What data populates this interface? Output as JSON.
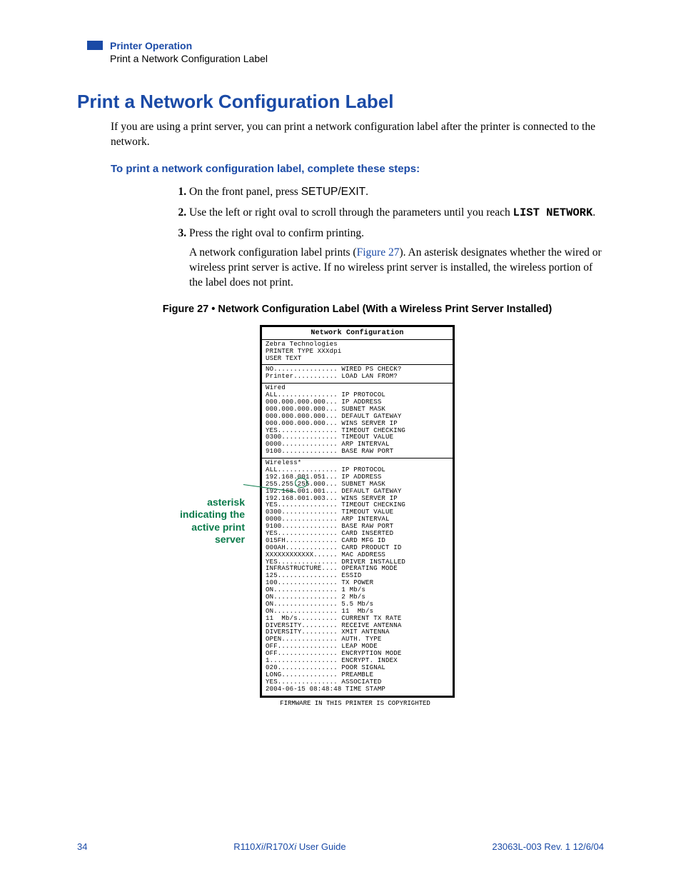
{
  "header": {
    "line1": "Printer Operation",
    "line2": "Print a Network Configuration Label"
  },
  "title": "Print a Network Configuration Label",
  "intro": "If you are using a print server, you can print a network configuration label after the printer is connected to the network.",
  "stepsHeading": "To print a network configuration label, complete these steps:",
  "steps": {
    "s1a": "On the front panel, press ",
    "s1b": "SETUP/EXIT",
    "s1c": ".",
    "s2a": "Use the left or right oval to scroll through the parameters until you reach ",
    "s2b": "LIST NETWORK",
    "s2c": ".",
    "s3a": "Press the right oval to confirm printing.",
    "s3b_a": "A network configuration label prints (",
    "s3b_link": "Figure 27",
    "s3b_b": "). An asterisk designates whether the wired or wireless print server is active. If no wireless print server is installed, the wireless portion of the label does not print."
  },
  "figCaption": "Figure 27 • Network Configuration Label (With a Wireless Print Server Installed)",
  "annotation": "asterisk indicating the active print server",
  "label": {
    "title": "Network Configuration",
    "sec1": "Zebra Technologies\nPRINTER TYPE XXXdpi\nUSER TEXT",
    "sec2": "NO................ WIRED PS CHECK?\nPrinter........... LOAD LAN FROM?",
    "sec3": "Wired\nALL............... IP PROTOCOL\n000.000.000.000... IP ADDRESS\n000.000.000.000... SUBNET MASK\n000.000.000.000... DEFAULT GATEWAY\n000.000.000.000... WINS SERVER IP\nYES............... TIMEOUT CHECKING\n0300.............. TIMEOUT VALUE\n0000.............. ARP INTERVAL\n9100.............. BASE RAW PORT",
    "sec4": "Wireless*\nALL............... IP PROTOCOL\n192.168.001.051... IP ADDRESS\n255.255.255.000... SUBNET MASK\n192.168.001.001... DEFAULT GATEWAY\n192.168.001.003... WINS SERVER IP\nYES............... TIMEOUT CHECKING\n0300.............. TIMEOUT VALUE\n0000.............. ARP INTERVAL\n9100.............. BASE RAW PORT\nYES............... CARD INSERTED\n015FH............. CARD MFG ID\n000AH............. CARD PRODUCT ID\nXXXXXXXXXXXX...... MAC ADDRESS\nYES............... DRIVER INSTALLED\nINFRASTRUCTURE.... OPERATING MODE\n125............... ESSID\n100............... TX POWER\nON................ 1 Mb/s\nON................ 2 Mb/s\nON................ 5.5 Mb/s\nON................ 11  Mb/s\n11  Mb/s.......... CURRENT TX RATE\nDIVERSITY......... RECEIVE ANTENNA\nDIVERSITY......... XMIT ANTENNA\nOPEN.............. AUTH. TYPE\nOFF............... LEAP MODE\nOFF............... ENCRYPTION MODE\n1................. ENCRYPT. INDEX\n020............... POOR SIGNAL\nLONG.............. PREAMBLE\nYES............... ASSOCIATED\n2004-06-15 08:48:48 TIME STAMP"
  },
  "copyrightNote": "FIRMWARE IN THIS PRINTER IS COPYRIGHTED",
  "footer": {
    "pageNum": "34",
    "center_a": "R110",
    "center_b": "Xi",
    "center_c": "/R170",
    "center_d": "Xi",
    "center_e": " User Guide",
    "right": "23063L-003 Rev. 1   12/6/04"
  }
}
